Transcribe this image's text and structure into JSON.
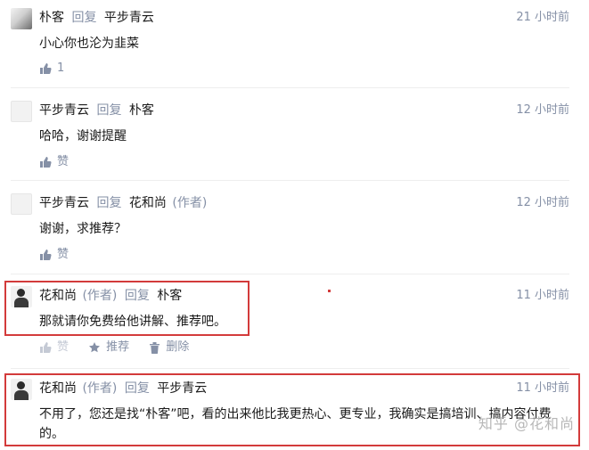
{
  "comments": [
    {
      "user": "朴客",
      "reply_label": "回复",
      "reply_to": "平步青云",
      "author_tag": "",
      "time": "21 小时前",
      "content": "小心你也沦为韭菜",
      "actions": {
        "like": "1"
      }
    },
    {
      "user": "平步青云",
      "reply_label": "回复",
      "reply_to": "朴客",
      "author_tag": "",
      "time": "12 小时前",
      "content": "哈哈，谢谢提醒",
      "actions": {
        "like": "赞"
      }
    },
    {
      "user": "平步青云",
      "reply_label": "回复",
      "reply_to": "花和尚",
      "reply_to_tag": "(作者)",
      "time": "12 小时前",
      "content": "谢谢，求推荐？",
      "actions": {
        "like": "赞"
      }
    },
    {
      "user": "花和尚",
      "author_tag": "(作者)",
      "reply_label": "回复",
      "reply_to": "朴客",
      "time": "11 小时前",
      "content": "那就请你免费给他讲解、推荐吧。",
      "actions": {
        "like": "赞",
        "recommend": "推荐",
        "delete": "删除"
      }
    },
    {
      "user": "花和尚",
      "author_tag": "(作者)",
      "reply_label": "回复",
      "reply_to": "平步青云",
      "time": "11 小时前",
      "content": "不用了，您还是找“朴客”吧，看的出来他比我更热心、更专业，我确实是搞培训、搞内容付费的。"
    }
  ],
  "watermark": "知乎 @花和尚",
  "colors": {
    "highlight": "#d33b3b",
    "meta": "#8590a6"
  }
}
